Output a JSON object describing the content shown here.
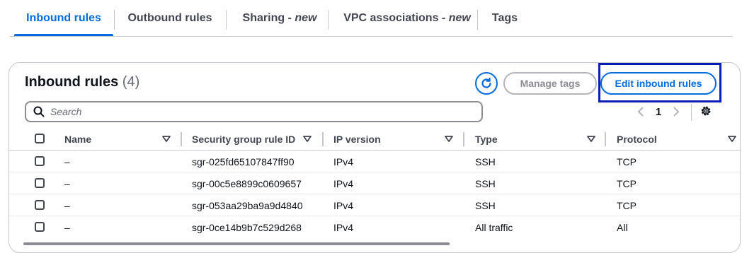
{
  "tabs": [
    {
      "label": "Inbound rules",
      "suffix": ""
    },
    {
      "label": "Outbound rules",
      "suffix": ""
    },
    {
      "label": "Sharing - ",
      "suffix": "new"
    },
    {
      "label": "VPC associations - ",
      "suffix": "new"
    },
    {
      "label": "Tags",
      "suffix": ""
    }
  ],
  "panel": {
    "title": "Inbound rules",
    "count": "(4)",
    "manage_tags_label": "Manage tags",
    "edit_rules_label": "Edit inbound rules"
  },
  "search": {
    "placeholder": "Search"
  },
  "pagination": {
    "current_page": "1"
  },
  "columns": [
    "Name",
    "Security group rule ID",
    "IP version",
    "Type",
    "Protocol"
  ],
  "rows": [
    {
      "name": "–",
      "rule_id": "sgr-025fd65107847ff90",
      "ip_version": "IPv4",
      "type": "SSH",
      "protocol": "TCP"
    },
    {
      "name": "–",
      "rule_id": "sgr-00c5e8899c0609657",
      "ip_version": "IPv4",
      "type": "SSH",
      "protocol": "TCP"
    },
    {
      "name": "–",
      "rule_id": "sgr-053aa29ba9a9d4840",
      "ip_version": "IPv4",
      "type": "SSH",
      "protocol": "TCP"
    },
    {
      "name": "–",
      "rule_id": "sgr-0ce14b9b7c529d268",
      "ip_version": "IPv4",
      "type": "All traffic",
      "protocol": "All"
    }
  ],
  "colors": {
    "accent": "#006ce0",
    "highlight": "#0a1fb5",
    "text": "#0f141a",
    "muted": "#424650"
  }
}
